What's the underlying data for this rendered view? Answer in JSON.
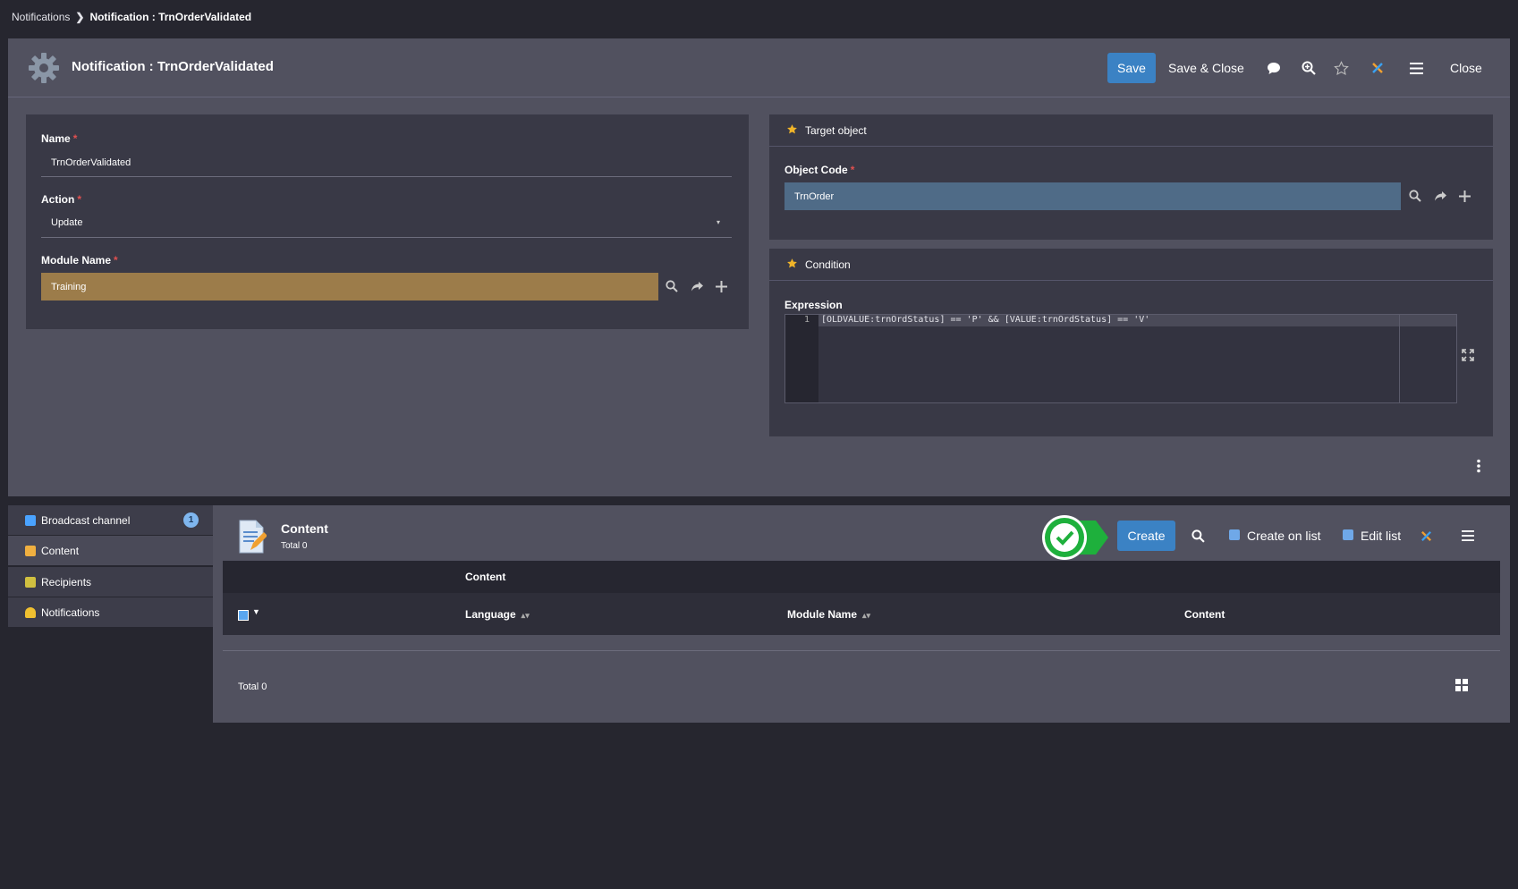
{
  "breadcrumb": {
    "root": "Notifications",
    "current": "Notification : TrnOrderValidated"
  },
  "form": {
    "title": "Notification : TrnOrderValidated",
    "buttons": {
      "save": "Save",
      "save_close": "Save & Close",
      "close": "Close"
    },
    "name": {
      "label": "Name",
      "value": "TrnOrderValidated"
    },
    "action": {
      "label": "Action",
      "value": "Update"
    },
    "module": {
      "label": "Module Name",
      "value": "Training"
    },
    "target": {
      "section": "Target object",
      "label": "Object Code",
      "value": "TrnOrder"
    },
    "condition": {
      "section": "Condition",
      "label": "Expression",
      "line_number": "1",
      "code": "[OLDVALUE:trnOrdStatus] == 'P' && [VALUE:trnOrdStatus] == 'V'"
    }
  },
  "tabs": [
    {
      "label": "Broadcast channel",
      "badge": "1",
      "icon": "broadcast-icon",
      "color": "#4aa3ff"
    },
    {
      "label": "Content",
      "icon": "content-icon",
      "color": "#f0b040"
    },
    {
      "label": "Recipients",
      "icon": "recipients-icon",
      "color": "#d0c040"
    },
    {
      "label": "Notifications",
      "icon": "bell-icon",
      "color": "#f0c030"
    }
  ],
  "content": {
    "title": "Content",
    "total_top": "Total 0",
    "buttons": {
      "create": "Create",
      "create_on_list": "Create on list",
      "edit_list": "Edit list"
    },
    "group_header": "Content",
    "columns": [
      "Language",
      "Module Name",
      "Content"
    ],
    "total_bottom": "Total 0"
  },
  "colors": {
    "accent": "#3b82c4",
    "module_field": "#9c7c4a",
    "object_field": "#4f6b87"
  }
}
